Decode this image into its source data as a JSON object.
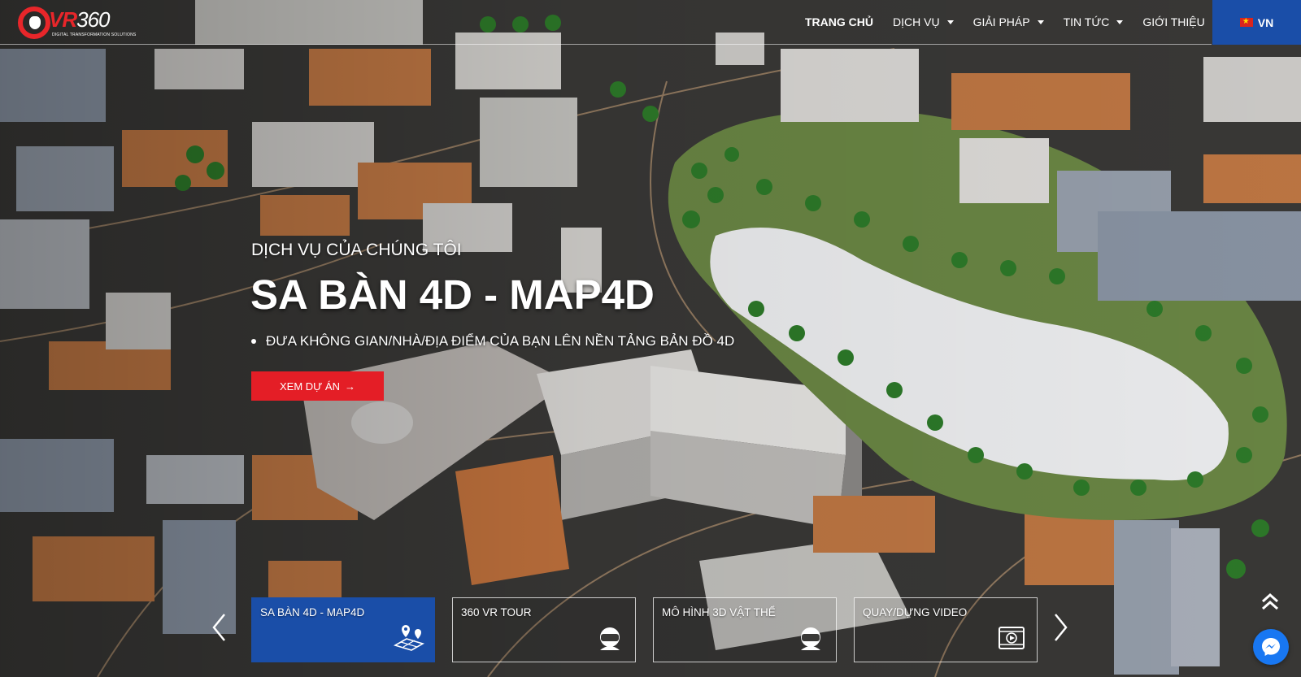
{
  "brand": {
    "logo_text": "VR",
    "logo_number": "360",
    "tagline": "DIGITAL TRANSFORMATION SOLUTIONS"
  },
  "nav": {
    "items": [
      {
        "label": "TRANG CHỦ",
        "active": true,
        "has_dropdown": false
      },
      {
        "label": "DỊCH VỤ",
        "active": false,
        "has_dropdown": true
      },
      {
        "label": "GIẢI PHÁP",
        "active": false,
        "has_dropdown": true
      },
      {
        "label": "TIN TỨC",
        "active": false,
        "has_dropdown": true
      },
      {
        "label": "GIỚI THIỆU",
        "active": false,
        "has_dropdown": false
      }
    ],
    "language": "VN"
  },
  "hero": {
    "subtitle": "DỊCH VỤ CỦA CHÚNG TÔI",
    "title": "SA BÀN 4D - MAP4D",
    "bullet": "ĐƯA KHÔNG GIAN/NHÀ/ĐỊA ĐIỂM CỦA BẠN LÊN NỀN TẢNG BẢN ĐỒ 4D",
    "cta_label": "XEM DỰ ÁN",
    "cta_arrow": "→"
  },
  "services": [
    {
      "label": "SA BÀN 4D - MAP4D",
      "icon": "map-grid-icon",
      "active": true
    },
    {
      "label": "360 VR TOUR",
      "icon": "vr-headset-icon",
      "active": false
    },
    {
      "label": "MÔ HÌNH 3D VẬT THỂ",
      "icon": "vr-headset-icon",
      "active": false
    },
    {
      "label": "QUAY/DỰNG VIDEO",
      "icon": "video-film-icon",
      "active": false
    }
  ],
  "colors": {
    "brand_blue": "#1a4ea8",
    "brand_red": "#e41e26",
    "messenger_blue": "#1877f2"
  }
}
